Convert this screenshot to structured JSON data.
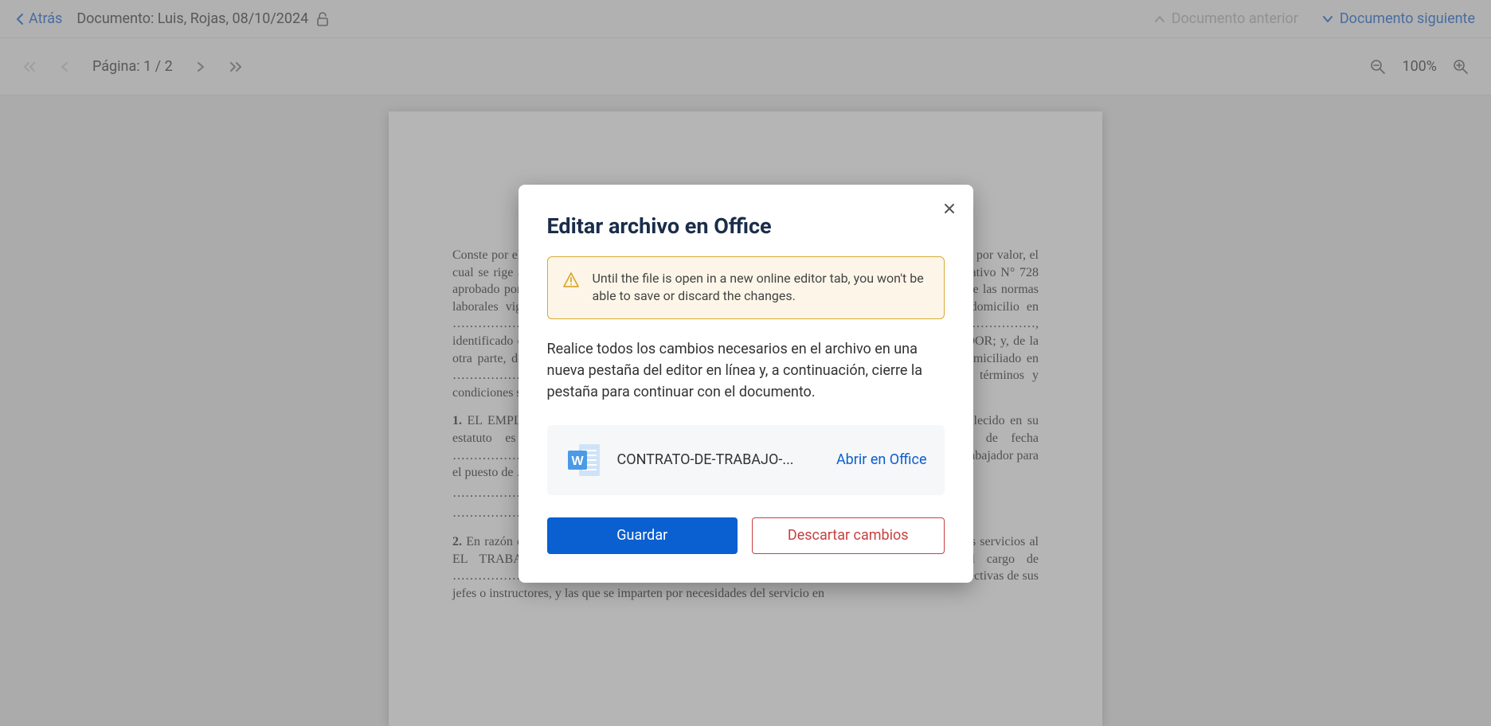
{
  "header": {
    "back_label": "Atrás",
    "doc_title": "Documento: Luis, Rojas, 08/10/2024",
    "prev_doc_label": "Documento anterior",
    "next_doc_label": "Documento siguiente"
  },
  "pagebar": {
    "page_label": "Página: 1 / 2",
    "zoom_label": "100%"
  },
  "document": {
    "p1": "Conste por el presente documento el Contrato de Trabajo a plazo fijo bajo la modalidad de \"Contrato por valor, el cual se rige adicionalmente por lo establecido en los artículos correspondientes del Decreto Legislativo N° 728 aprobado por el D.S. N° 003-97-TR que regula el marco legaletitividad Laboral bajo los alcances de las normas laborales vigentes …………………………………..(1), con R.U.C. N° ………………….. con domicilio en ………………………………, debidamente representado para estos efectos por …………………………………, identificado con D.N.I. N° ………………….., a quien en adelante se le denominará EL EMPLEADOR; y, de la otra parte, don(ña) ………………..………., identificado(a) con D.N.I. N° ……………………, domiciliado en …………………………., a quien en adelante se le denominará EL TRABAJADOR; en los términos y condiciones siguientes:",
    "p2_num": "1.",
    "p2": "EL EMPLEADOR es una empresa dedicada a la actividad económica cuyo objeto social establecido en su estatuto es ……………………, con fecha de inscripción en los Registros Públicos de fecha ………………………………, la cual requiere cubrir temporalmente a partir de los servicios de un trabajador para el puesto de ………………………… .",
    "p2_dots": "………………………………………………………………………………………………………..",
    "p3_num": "2.",
    "p3": "En razón de las causas objetivas señaladas en la cláusula anterior, EL EMPLEADOR contrata los servicios al EL TRABAJADOR a plazo fijo y bajo la modalidad señalada, para que ocupe el cargo de ……………………………, realizando las labores propias y complementarias del puesto, bajo las directivas de sus jefes o instructores, y las que se imparten por necesidades del servicio en"
  },
  "dialog": {
    "title": "Editar archivo en Office",
    "warning_text": "Until the file is open in a new online editor tab, you won't be able to save or discard the changes.",
    "body_text": "Realice todos los cambios necesarios en el archivo en una nueva pestaña del editor en línea y, a continuación, cierre la pestaña para continuar con el documento.",
    "file_name": "CONTRATO-DE-TRABAJO-...",
    "open_label": "Abrir en Office",
    "save_label": "Guardar",
    "discard_label": "Descartar cambios"
  }
}
